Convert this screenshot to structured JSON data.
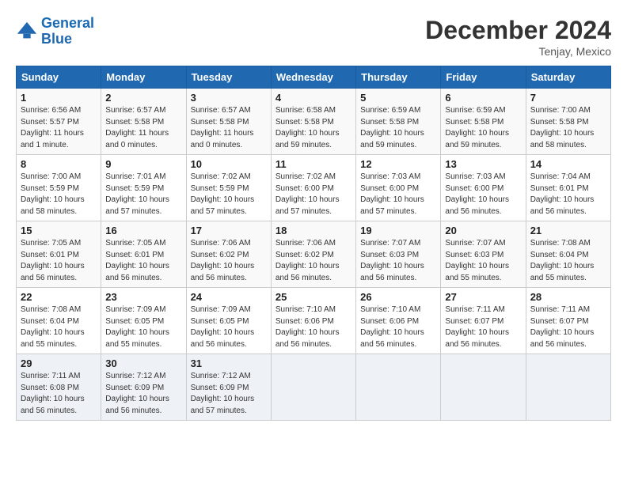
{
  "logo": {
    "line1": "General",
    "line2": "Blue"
  },
  "title": "December 2024",
  "location": "Tenjay, Mexico",
  "days_of_week": [
    "Sunday",
    "Monday",
    "Tuesday",
    "Wednesday",
    "Thursday",
    "Friday",
    "Saturday"
  ],
  "weeks": [
    [
      {
        "day": "1",
        "info": "Sunrise: 6:56 AM\nSunset: 5:57 PM\nDaylight: 11 hours\nand 1 minute."
      },
      {
        "day": "2",
        "info": "Sunrise: 6:57 AM\nSunset: 5:58 PM\nDaylight: 11 hours\nand 0 minutes."
      },
      {
        "day": "3",
        "info": "Sunrise: 6:57 AM\nSunset: 5:58 PM\nDaylight: 11 hours\nand 0 minutes."
      },
      {
        "day": "4",
        "info": "Sunrise: 6:58 AM\nSunset: 5:58 PM\nDaylight: 10 hours\nand 59 minutes."
      },
      {
        "day": "5",
        "info": "Sunrise: 6:59 AM\nSunset: 5:58 PM\nDaylight: 10 hours\nand 59 minutes."
      },
      {
        "day": "6",
        "info": "Sunrise: 6:59 AM\nSunset: 5:58 PM\nDaylight: 10 hours\nand 59 minutes."
      },
      {
        "day": "7",
        "info": "Sunrise: 7:00 AM\nSunset: 5:58 PM\nDaylight: 10 hours\nand 58 minutes."
      }
    ],
    [
      {
        "day": "8",
        "info": "Sunrise: 7:00 AM\nSunset: 5:59 PM\nDaylight: 10 hours\nand 58 minutes."
      },
      {
        "day": "9",
        "info": "Sunrise: 7:01 AM\nSunset: 5:59 PM\nDaylight: 10 hours\nand 57 minutes."
      },
      {
        "day": "10",
        "info": "Sunrise: 7:02 AM\nSunset: 5:59 PM\nDaylight: 10 hours\nand 57 minutes."
      },
      {
        "day": "11",
        "info": "Sunrise: 7:02 AM\nSunset: 6:00 PM\nDaylight: 10 hours\nand 57 minutes."
      },
      {
        "day": "12",
        "info": "Sunrise: 7:03 AM\nSunset: 6:00 PM\nDaylight: 10 hours\nand 57 minutes."
      },
      {
        "day": "13",
        "info": "Sunrise: 7:03 AM\nSunset: 6:00 PM\nDaylight: 10 hours\nand 56 minutes."
      },
      {
        "day": "14",
        "info": "Sunrise: 7:04 AM\nSunset: 6:01 PM\nDaylight: 10 hours\nand 56 minutes."
      }
    ],
    [
      {
        "day": "15",
        "info": "Sunrise: 7:05 AM\nSunset: 6:01 PM\nDaylight: 10 hours\nand 56 minutes."
      },
      {
        "day": "16",
        "info": "Sunrise: 7:05 AM\nSunset: 6:01 PM\nDaylight: 10 hours\nand 56 minutes."
      },
      {
        "day": "17",
        "info": "Sunrise: 7:06 AM\nSunset: 6:02 PM\nDaylight: 10 hours\nand 56 minutes."
      },
      {
        "day": "18",
        "info": "Sunrise: 7:06 AM\nSunset: 6:02 PM\nDaylight: 10 hours\nand 56 minutes."
      },
      {
        "day": "19",
        "info": "Sunrise: 7:07 AM\nSunset: 6:03 PM\nDaylight: 10 hours\nand 56 minutes."
      },
      {
        "day": "20",
        "info": "Sunrise: 7:07 AM\nSunset: 6:03 PM\nDaylight: 10 hours\nand 55 minutes."
      },
      {
        "day": "21",
        "info": "Sunrise: 7:08 AM\nSunset: 6:04 PM\nDaylight: 10 hours\nand 55 minutes."
      }
    ],
    [
      {
        "day": "22",
        "info": "Sunrise: 7:08 AM\nSunset: 6:04 PM\nDaylight: 10 hours\nand 55 minutes."
      },
      {
        "day": "23",
        "info": "Sunrise: 7:09 AM\nSunset: 6:05 PM\nDaylight: 10 hours\nand 55 minutes."
      },
      {
        "day": "24",
        "info": "Sunrise: 7:09 AM\nSunset: 6:05 PM\nDaylight: 10 hours\nand 56 minutes."
      },
      {
        "day": "25",
        "info": "Sunrise: 7:10 AM\nSunset: 6:06 PM\nDaylight: 10 hours\nand 56 minutes."
      },
      {
        "day": "26",
        "info": "Sunrise: 7:10 AM\nSunset: 6:06 PM\nDaylight: 10 hours\nand 56 minutes."
      },
      {
        "day": "27",
        "info": "Sunrise: 7:11 AM\nSunset: 6:07 PM\nDaylight: 10 hours\nand 56 minutes."
      },
      {
        "day": "28",
        "info": "Sunrise: 7:11 AM\nSunset: 6:07 PM\nDaylight: 10 hours\nand 56 minutes."
      }
    ],
    [
      {
        "day": "29",
        "info": "Sunrise: 7:11 AM\nSunset: 6:08 PM\nDaylight: 10 hours\nand 56 minutes."
      },
      {
        "day": "30",
        "info": "Sunrise: 7:12 AM\nSunset: 6:09 PM\nDaylight: 10 hours\nand 56 minutes."
      },
      {
        "day": "31",
        "info": "Sunrise: 7:12 AM\nSunset: 6:09 PM\nDaylight: 10 hours\nand 57 minutes."
      },
      {
        "day": "",
        "info": ""
      },
      {
        "day": "",
        "info": ""
      },
      {
        "day": "",
        "info": ""
      },
      {
        "day": "",
        "info": ""
      }
    ]
  ]
}
